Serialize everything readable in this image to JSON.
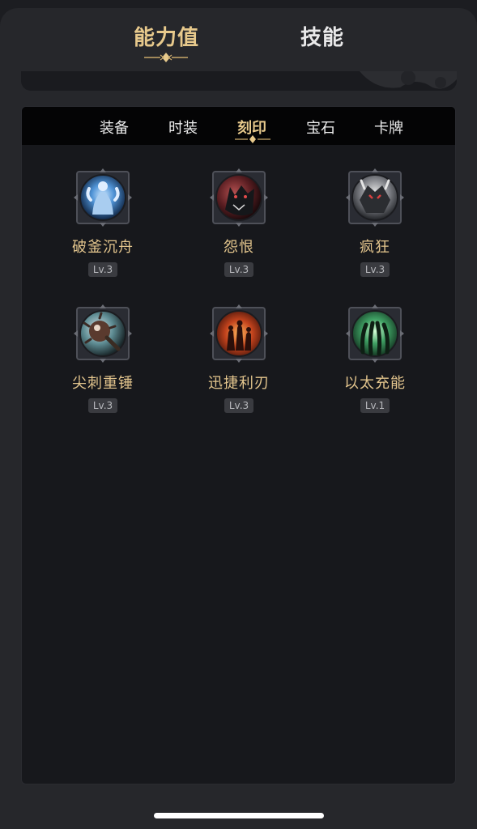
{
  "header": {
    "tabs": [
      {
        "label": "能力值",
        "active": true
      },
      {
        "label": "技能",
        "active": false
      }
    ]
  },
  "sub_tabs": [
    {
      "label": "装备",
      "active": false
    },
    {
      "label": "时装",
      "active": false
    },
    {
      "label": "刻印",
      "active": true
    },
    {
      "label": "宝石",
      "active": false
    },
    {
      "label": "卡牌",
      "active": false
    }
  ],
  "engravings": [
    {
      "name": "破釜沉舟",
      "level": "Lv.3",
      "icon": "muscular-warrior-icon"
    },
    {
      "name": "怨恨",
      "level": "Lv.3",
      "icon": "dark-wolf-icon"
    },
    {
      "name": "疯狂",
      "level": "Lv.3",
      "icon": "armored-beast-icon"
    },
    {
      "name": "尖刺重锤",
      "level": "Lv.3",
      "icon": "spiked-hammer-icon"
    },
    {
      "name": "迅捷利刃",
      "level": "Lv.3",
      "icon": "fiery-figures-icon"
    },
    {
      "name": "以太充能",
      "level": "Lv.1",
      "icon": "ether-claw-icon"
    }
  ],
  "colors": {
    "accent_gold": "#e7c98c",
    "background": "#17181c",
    "sub_tab_bar": "#040405"
  }
}
